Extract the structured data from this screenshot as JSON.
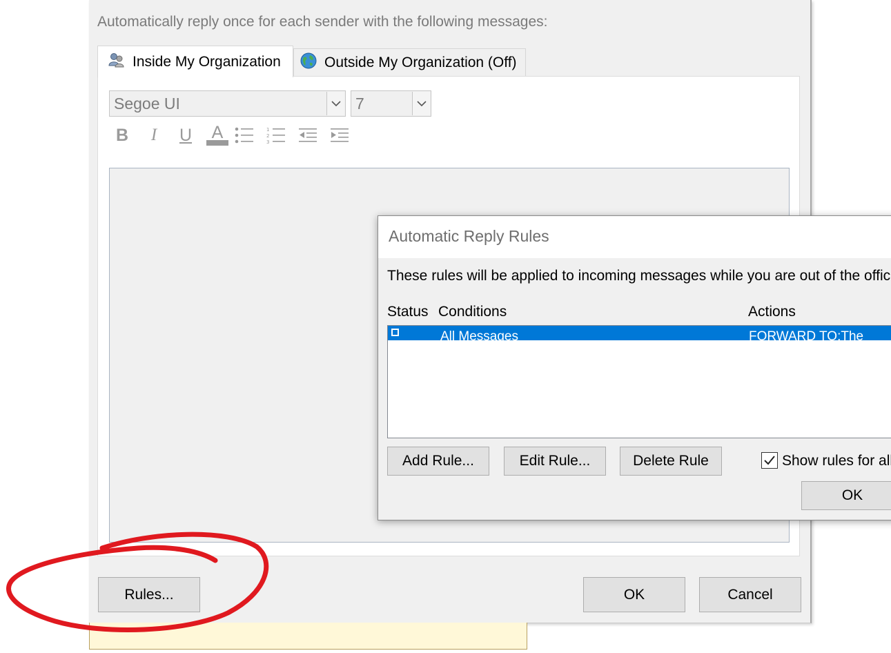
{
  "main_dialog": {
    "caption": "Automatically reply once for each sender with the following messages:",
    "tabs": [
      {
        "label": "Inside My Organization",
        "icon": "people-icon",
        "selected": true
      },
      {
        "label": "Outside My Organization (Off)",
        "icon": "globe-icon",
        "selected": false
      }
    ],
    "font_name": "Segoe UI",
    "font_size": "7",
    "format_buttons": {
      "bold": "B",
      "italic": "I",
      "underline": "U",
      "font_color": "A"
    },
    "buttons": {
      "rules": "Rules...",
      "ok": "OK",
      "cancel": "Cancel"
    }
  },
  "rules_dialog": {
    "title": "Automatic Reply Rules",
    "description": "These rules will be applied to incoming messages while you are out of the offic",
    "columns": {
      "status": "Status",
      "conditions": "Conditions",
      "actions": "Actions"
    },
    "rows": [
      {
        "status_checked": false,
        "conditions": "All Messages",
        "actions": "FORWARD TO:The",
        "selected": true
      }
    ],
    "buttons": {
      "add_rule": "Add Rule...",
      "edit_rule": "Edit Rule...",
      "delete_rule": "Delete Rule",
      "ok": "OK"
    },
    "show_rules_label": "Show rules for all",
    "show_rules_checked": true
  },
  "colors": {
    "selection": "#0078d7",
    "annotation": "#e0191f",
    "dialog_bg": "#f0f0f0"
  }
}
